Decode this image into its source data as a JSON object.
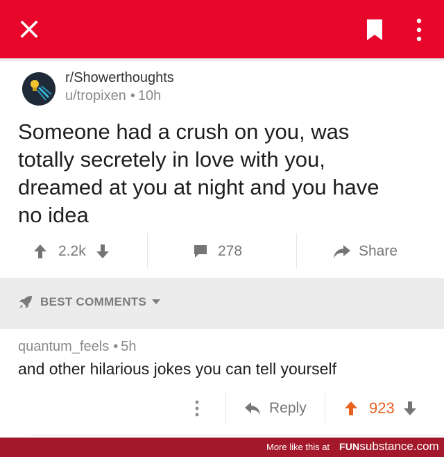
{
  "topbar": {
    "accent": "#e8062b"
  },
  "post": {
    "subreddit": "r/Showerthoughts",
    "author": "u/tropixen",
    "age": "10h",
    "title": "Someone had a crush on you, was totally secretely in love with you, dreamed at you at night and you have no idea",
    "upvotes": "2.2k",
    "comments": "278",
    "share_label": "Share"
  },
  "sort": {
    "label": "BEST COMMENTS"
  },
  "comment": {
    "author": "quantum_feels",
    "age": "5h",
    "text": "and other hilarious jokes you can tell yourself",
    "reply_label": "Reply",
    "score": "923"
  },
  "footer": {
    "more_label": "More like this at",
    "brand_prefix": "FUN",
    "brand_suffix": "substance.com"
  },
  "icons": [
    "close-icon",
    "bookmark-icon",
    "more-vert-icon",
    "avatar-lightbulb",
    "upvote-arrow-icon",
    "downvote-arrow-icon",
    "comment-bubble-icon",
    "share-arrow-icon",
    "rocket-icon",
    "chevron-down-icon",
    "reply-arrow-icon"
  ],
  "colors": {
    "accent_red": "#e8062b",
    "vote_orange": "#e8611f",
    "footer_red": "#a3182a",
    "muted_gray": "#757575"
  }
}
